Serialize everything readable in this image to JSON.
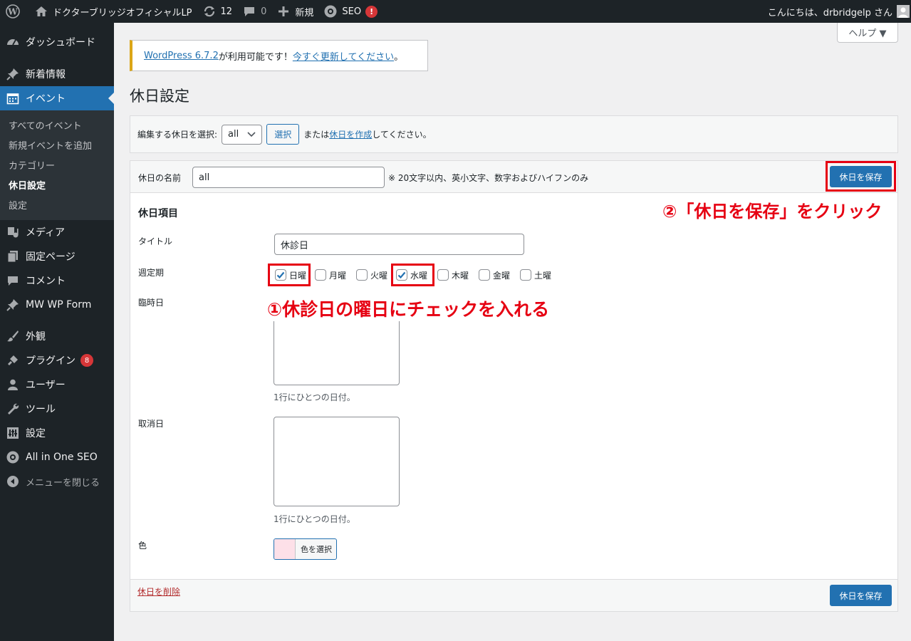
{
  "adminbar": {
    "site_name": "ドクターブリッジオフィシャルLP",
    "updates_count": "12",
    "comments_count": "0",
    "new_label": "新規",
    "seo_label": "SEO",
    "seo_badge": "!",
    "greeting": "こんにちは、drbridgelp さん"
  },
  "sidebar": {
    "dashboard": "ダッシュボード",
    "news": "新着情報",
    "events": "イベント",
    "submenu": [
      "すべてのイベント",
      "新規イベントを追加",
      "カテゴリー",
      "休日設定",
      "設定"
    ],
    "media": "メディア",
    "pages": "固定ページ",
    "comments": "コメント",
    "mwwpform": "MW WP Form",
    "appearance": "外観",
    "plugins": "プラグイン",
    "plugins_badge": "8",
    "users": "ユーザー",
    "tools": "ツール",
    "settings": "設定",
    "aioseo": "All in One SEO",
    "collapse": "メニューを閉じる"
  },
  "help_tab": "ヘルプ ▼",
  "notice": {
    "link1": "WordPress 6.7.2",
    "mid": " が利用可能です！",
    "link2": "今すぐ更新してください",
    "end": "。"
  },
  "page_title": "休日設定",
  "select_bar": {
    "label": "編集する休日を選択:",
    "selected": "all",
    "select_button": "選択",
    "or_text": "または",
    "create_link": "休日を作成",
    "suffix": "してください。"
  },
  "form": {
    "name_label": "休日の名前",
    "name_value": "all",
    "name_hint": "※ 20文字以内、英小文字、数字およびハイフンのみ",
    "save_button": "休日を保存",
    "section_title": "休日項目",
    "title_label": "タイトル",
    "title_value": "休診日",
    "weekly_label": "週定期",
    "weekdays": [
      "日曜",
      "月曜",
      "火曜",
      "水曜",
      "木曜",
      "金曜",
      "土曜"
    ],
    "weekdays_checked": [
      true,
      false,
      false,
      true,
      false,
      false,
      false
    ],
    "temp_label": "臨時日",
    "temp_help": "1行にひとつの日付。",
    "cancel_label": "取消日",
    "cancel_help": "1行にひとつの日付。",
    "color_label": "色",
    "color_button": "色を選択",
    "color_value": "#fde0e8",
    "delete_link": "休日を削除",
    "save_button_bottom": "休日を保存"
  },
  "annotations": {
    "step1": "①休診日の曜日にチェックを入れる",
    "step2": "②「休日を保存」をクリック"
  }
}
